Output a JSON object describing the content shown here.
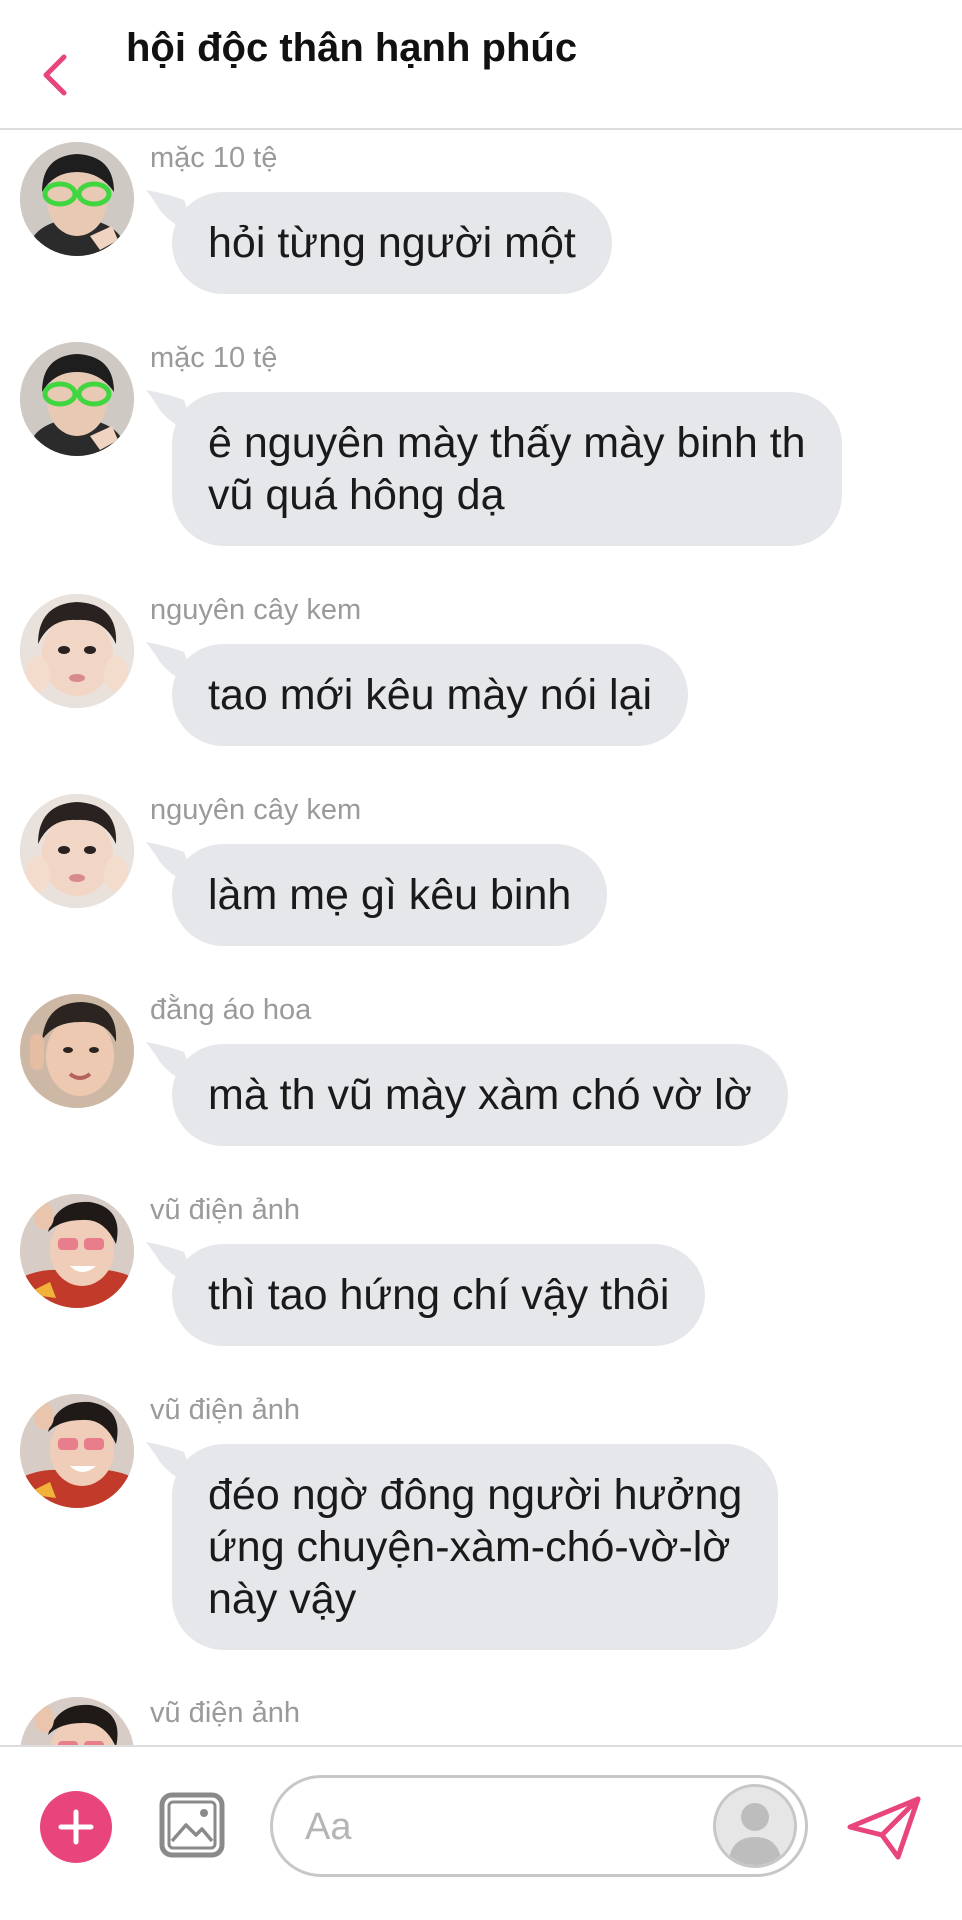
{
  "header": {
    "title": "hội độc thân hạnh phúc",
    "back_icon": "chevron-left-icon",
    "accent_color": "#e9457d"
  },
  "messages": [
    {
      "sender": "mặc 10 tệ",
      "avatar": "green-alien-glasses-avatar",
      "lines": [
        "hỏi từng người một"
      ]
    },
    {
      "sender": "mặc 10 tệ",
      "avatar": "green-alien-glasses-avatar",
      "lines": [
        "ê nguyên mày thấy mày binh th",
        "vũ quá hông dạ"
      ]
    },
    {
      "sender": "nguyên cây kem",
      "avatar": "cheek-squish-avatar",
      "lines": [
        "tao mới kêu mày nói lại"
      ]
    },
    {
      "sender": "nguyên cây kem",
      "avatar": "cheek-squish-avatar",
      "lines": [
        "làm mẹ gì kêu binh"
      ]
    },
    {
      "sender": "đằng áo hoa",
      "avatar": "selfie-avatar",
      "lines": [
        "mà th vũ mày xàm chó vờ lờ"
      ]
    },
    {
      "sender": "vũ điện ảnh",
      "avatar": "pink-sunglasses-avatar",
      "lines": [
        "thì tao hứng chí vậy thôi"
      ]
    },
    {
      "sender": "vũ điện ảnh",
      "avatar": "pink-sunglasses-avatar",
      "lines": [
        "đéo ngờ đông người hưởng",
        "ứng chuyện-xàm-chó-vờ-lờ",
        "này vậy"
      ]
    },
    {
      "sender": "vũ điện ảnh",
      "avatar": "pink-sunglasses-avatar",
      "lines": []
    }
  ],
  "composer": {
    "placeholder": "Aa",
    "plus_icon": "plus-icon",
    "image_icon": "image-icon",
    "sticker_icon": "avatar-placeholder-icon",
    "send_icon": "send-icon"
  },
  "colors": {
    "accent": "#e9457d",
    "bubble": "#e5e7ea",
    "sender_text": "#9a9a9a"
  }
}
